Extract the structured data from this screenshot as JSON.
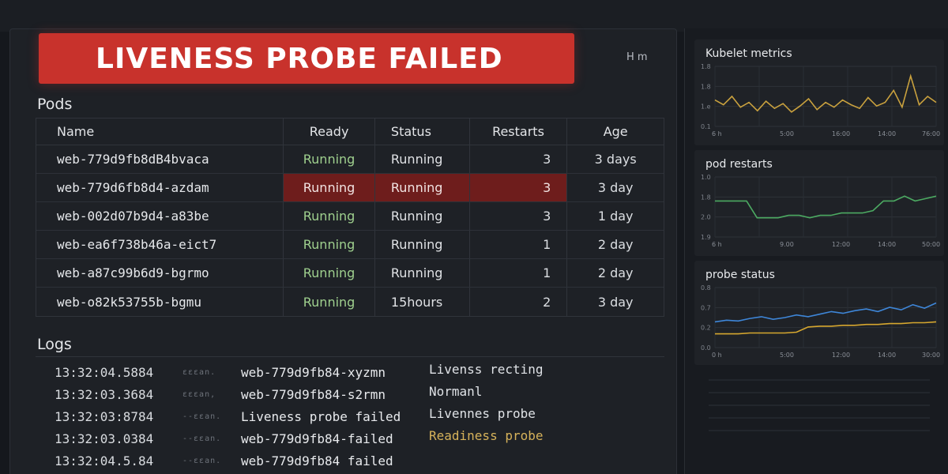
{
  "alert": {
    "title": "LIVENESS PROBE FAILED",
    "hm": "H m"
  },
  "pods": {
    "title": "Pods",
    "columns": [
      "Name",
      "Ready",
      "Status",
      "Restarts",
      "Age"
    ],
    "rows": [
      {
        "name": "web-779d9fb8dB4bvaca",
        "ready": "Running",
        "status": "Running",
        "restarts": "3",
        "age": "3 days"
      },
      {
        "name": "web-779d6fb8d4-azdam",
        "ready": "Running",
        "status": "Running",
        "restarts": "3",
        "age": "3 day"
      },
      {
        "name": "web-002d07b9d4-a83be",
        "ready": "Running",
        "status": "Running",
        "restarts": "3",
        "age": "1 day"
      },
      {
        "name": "web-ea6f738b46a-eict7",
        "ready": "Running",
        "status": "Running",
        "restarts": "1",
        "age": "2 day"
      },
      {
        "name": "web-a87c99b6d9-bgrmo",
        "ready": "Running",
        "status": "Running",
        "restarts": "1",
        "age": "2 day"
      },
      {
        "name": "web-o82k53755b-bgmu",
        "ready": "Running",
        "status": "15hours",
        "restarts": "2",
        "age": "3 day"
      }
    ],
    "highlight_row": 1,
    "highlight_color": "#6e1d1c"
  },
  "logs": {
    "title": "Logs",
    "lines": [
      {
        "ts": "13:32:04.5884",
        "level": "ɛɛɛan.",
        "pod": "web-779d9fb84-xyzmn",
        "msg": "Livenss recting"
      },
      {
        "ts": "13:32:03.3684",
        "level": "ɛɛɛan,",
        "pod": "web-779d9fb84-s2rmn",
        "msg": "Normanl"
      },
      {
        "ts": "13:32:03:8784",
        "level": "--ɛɛan.",
        "pod": "Liveness probe failed",
        "msg": "Livennes probe"
      },
      {
        "ts": "13:32:03.0384",
        "level": "--ɛɛan.",
        "pod": "web-779d9fb84-failed",
        "msg": "Readiness probe",
        "warn": true
      },
      {
        "ts": "13:32:04.5.84",
        "level": "--ɛɛan.",
        "pod": "web-779d9fb84 failed",
        "msg": ""
      }
    ]
  },
  "panels": {
    "kubelet": {
      "title": "Kubelet metrics",
      "y_ticks": [
        "1.8",
        "1.8",
        "1.e",
        "0.1"
      ],
      "x_ticks": [
        "6 h",
        "5:00",
        "16:00",
        "14:00",
        "76:00"
      ]
    },
    "restarts": {
      "title": "pod restarts",
      "y_ticks": [
        "1.0",
        "1.8",
        "2.0",
        "1.9"
      ],
      "x_ticks": [
        "6 h",
        "9.00",
        "12:00",
        "14:00",
        "50:00"
      ]
    },
    "probe": {
      "title": "probe status",
      "y_ticks": [
        "0.8",
        "0.7",
        "0.2",
        "0.0"
      ],
      "x_ticks": [
        "0 h",
        "5:00",
        "12:00",
        "14:00",
        "30:00"
      ]
    }
  },
  "chart_data": [
    {
      "type": "line",
      "title": "Kubelet metrics",
      "series": [
        {
          "color": "#c9a13e",
          "values": [
            1.42,
            1.38,
            1.45,
            1.36,
            1.4,
            1.33,
            1.41,
            1.35,
            1.39,
            1.32,
            1.37,
            1.43,
            1.34,
            1.4,
            1.36,
            1.42,
            1.38,
            1.35,
            1.44,
            1.37,
            1.4,
            1.5,
            1.36,
            1.62,
            1.38,
            1.45,
            1.4
          ]
        }
      ]
    },
    {
      "type": "line",
      "title": "pod restarts",
      "series": [
        {
          "color": "#4caa62",
          "values": [
            2.0,
            2.0,
            2.0,
            2.0,
            1.93,
            1.93,
            1.93,
            1.94,
            1.94,
            1.93,
            1.94,
            1.94,
            1.95,
            1.95,
            1.95,
            1.96,
            2.0,
            2.0,
            2.02,
            2.0,
            2.01,
            2.02
          ]
        }
      ]
    },
    {
      "type": "line",
      "title": "probe status",
      "series": [
        {
          "color": "#3e86d8",
          "values": [
            0.3,
            0.32,
            0.31,
            0.34,
            0.36,
            0.33,
            0.35,
            0.38,
            0.36,
            0.39,
            0.42,
            0.4,
            0.43,
            0.45,
            0.42,
            0.47,
            0.44,
            0.5,
            0.46,
            0.52
          ]
        },
        {
          "color": "#d6a72f",
          "values": [
            0.16,
            0.16,
            0.16,
            0.17,
            0.17,
            0.17,
            0.17,
            0.18,
            0.24,
            0.25,
            0.25,
            0.26,
            0.26,
            0.27,
            0.27,
            0.28,
            0.28,
            0.29,
            0.29,
            0.3
          ]
        }
      ]
    }
  ]
}
